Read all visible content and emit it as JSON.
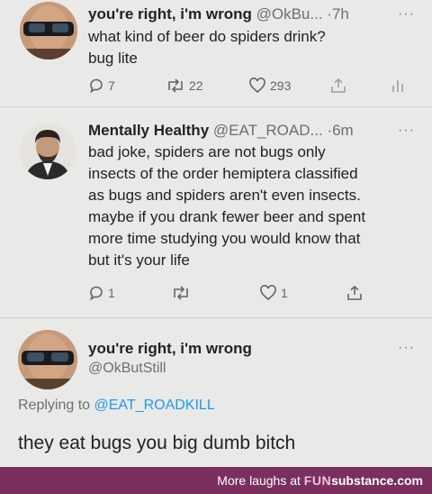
{
  "tweet1": {
    "name": "you're right, i'm wrong",
    "handle": "@OkBu...",
    "time": "·7h",
    "more": "···",
    "lines": [
      "what kind of beer do spiders drink?",
      "bug lite"
    ],
    "reply_count": "7",
    "retweet_count": "22",
    "like_count": "293"
  },
  "tweet2": {
    "name": "Mentally Healthy",
    "handle": "@EAT_ROAD...",
    "time": "·6m",
    "more": "···",
    "lines": [
      "bad joke, spiders are not bugs only",
      "insects of the order hemiptera classified",
      "as bugs and spiders aren't even insects.",
      "maybe if you drank fewer beer and spent",
      "more time studying you would know that",
      "but it's your life"
    ],
    "reply_count": "1",
    "like_count": "1"
  },
  "tweet3": {
    "name": "you're right, i'm wrong",
    "handle": "@OkButStill",
    "more": "···",
    "replying_prefix": "Replying to",
    "replying_to": "@EAT_ROADKILL",
    "text": "they eat bugs you big dumb bitch"
  },
  "footer": {
    "prefix": "More laughs at",
    "brand_fun": "FUN",
    "brand_rest": "substance.com"
  },
  "colors": {
    "background": "#e9e9e7",
    "link": "#1d9bf0",
    "footer_bg": "#7a2f5e"
  }
}
